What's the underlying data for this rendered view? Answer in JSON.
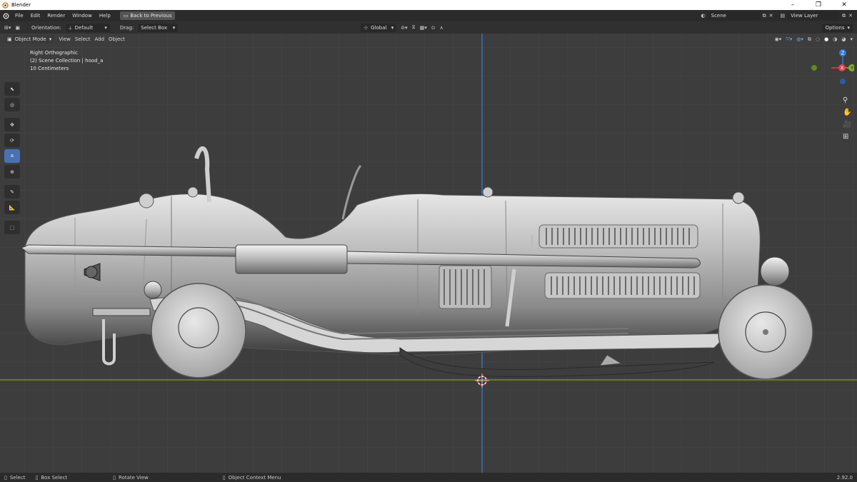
{
  "window": {
    "title": "Blender",
    "min": "–",
    "max": "❐",
    "close": "✕"
  },
  "menu": {
    "items": [
      "File",
      "Edit",
      "Render",
      "Window",
      "Help"
    ],
    "back": "Back to Previous",
    "scene": "Scene",
    "view_layer": "View Layer"
  },
  "toolheader": {
    "orientation_label": "Orientation:",
    "orientation_value": "Default",
    "drag_label": "Drag:",
    "drag_value": "Select Box",
    "transform_orientation": "Global",
    "options": "Options"
  },
  "viewheader": {
    "mode": "Object Mode",
    "view": "View",
    "select": "Select",
    "add": "Add",
    "object": "Object"
  },
  "overlay": {
    "view_name": "Right Orthographic",
    "collection": "(2) Scene Collection | hood_a",
    "scale": "10 Centimeters"
  },
  "gizmo": {
    "z": "Z",
    "x": "X",
    "y": "Y"
  },
  "status": {
    "select": "Select",
    "box_select": "Box Select",
    "rotate": "Rotate View",
    "context": "Object Context Menu",
    "version": "2.92.0"
  },
  "colors": {
    "accent": "#4772b3",
    "z_axis": "#2f7bd8",
    "y_axis_line": "#8a9a2b",
    "x_axis": "#e0404f",
    "y_axis": "#80b52a"
  }
}
